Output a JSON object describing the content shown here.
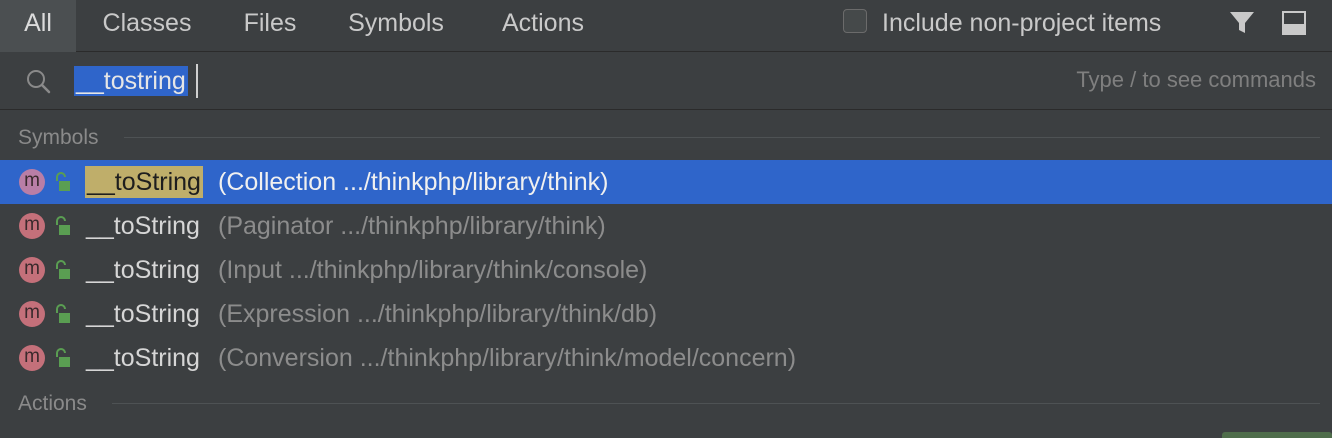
{
  "tabs": [
    {
      "label": "All",
      "active": true
    },
    {
      "label": "Classes",
      "active": false
    },
    {
      "label": "Files",
      "active": false
    },
    {
      "label": "Symbols",
      "active": false
    },
    {
      "label": "Actions",
      "active": false
    }
  ],
  "include_non_project": {
    "label": "Include non-project items",
    "checked": false
  },
  "toolbar_icons": [
    "filter-icon",
    "window-icon"
  ],
  "search": {
    "value": "__tostring",
    "hint": "Type / to see commands",
    "icon": "search-icon"
  },
  "sections": {
    "symbols": "Symbols",
    "actions": "Actions"
  },
  "results": [
    {
      "icon_letter": "m",
      "name": "__toString",
      "location": "(Collection .../thinkphp/library/think)",
      "selected": true
    },
    {
      "icon_letter": "m",
      "name": "__toString",
      "location": "(Paginator .../thinkphp/library/think)",
      "selected": false
    },
    {
      "icon_letter": "m",
      "name": "__toString",
      "location": "(Input .../thinkphp/library/think/console)",
      "selected": false
    },
    {
      "icon_letter": "m",
      "name": "__toString",
      "location": "(Expression .../thinkphp/library/think/db)",
      "selected": false
    },
    {
      "icon_letter": "m",
      "name": "__toString",
      "location": "(Conversion .../thinkphp/library/think/model/concern)",
      "selected": false
    }
  ],
  "colors": {
    "background": "#3c3f41",
    "selection": "#2f65ca",
    "match_highlight": "#bfae6a",
    "method_icon": "#c4707a",
    "lock_icon": "#5a9e52"
  }
}
